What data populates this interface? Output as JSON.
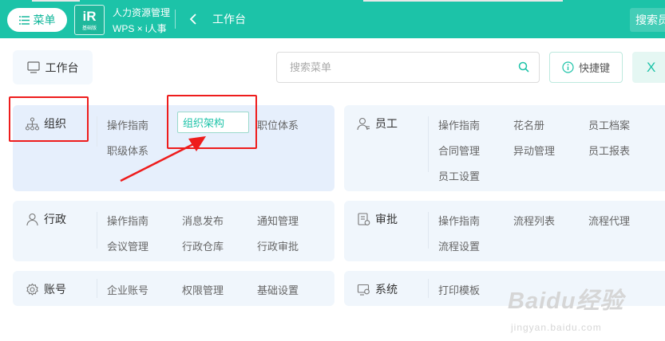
{
  "header": {
    "menu_label": "菜单",
    "logo_mark": "iR",
    "logo_sub": "基础版",
    "app_line1": "人力资源管理",
    "app_line2": "WPS × i人事",
    "page_title": "工作台",
    "search_text": "搜索员"
  },
  "toolbar": {
    "workbench_label": "工作台",
    "search_placeholder": "搜索菜单",
    "shortcut_label": "快捷键",
    "close_label": "X"
  },
  "modules": {
    "org": {
      "title": "组织",
      "items": [
        "操作指南",
        "组织架构",
        "职位体系",
        "职级体系"
      ]
    },
    "employee": {
      "title": "员工",
      "items": [
        "操作指南",
        "花名册",
        "员工档案",
        "合同管理",
        "异动管理",
        "员工报表",
        "员工设置"
      ]
    },
    "admin": {
      "title": "行政",
      "items": [
        "操作指南",
        "消息发布",
        "通知管理",
        "会议管理",
        "行政仓库",
        "行政审批"
      ]
    },
    "approval": {
      "title": "审批",
      "items": [
        "操作指南",
        "流程列表",
        "流程代理",
        "流程设置"
      ]
    },
    "account": {
      "title": "账号",
      "items": [
        "企业账号",
        "权限管理",
        "基础设置"
      ]
    },
    "system": {
      "title": "系统",
      "items": [
        "打印模板"
      ]
    }
  },
  "watermark": {
    "brand": "Baidu经验",
    "url": "jingyan.baidu.com"
  },
  "colors": {
    "accent": "#1cc3a8",
    "card": "#f0f6fc",
    "annotation": "#ee1c1c"
  },
  "icons": [
    "hamburger-icon",
    "chevron-left-icon",
    "monitor-icon",
    "search-icon",
    "info-icon",
    "org-tree-icon",
    "user-icon",
    "user-badge-icon",
    "doc-check-icon",
    "gear-icon",
    "monitor-settings-icon"
  ]
}
